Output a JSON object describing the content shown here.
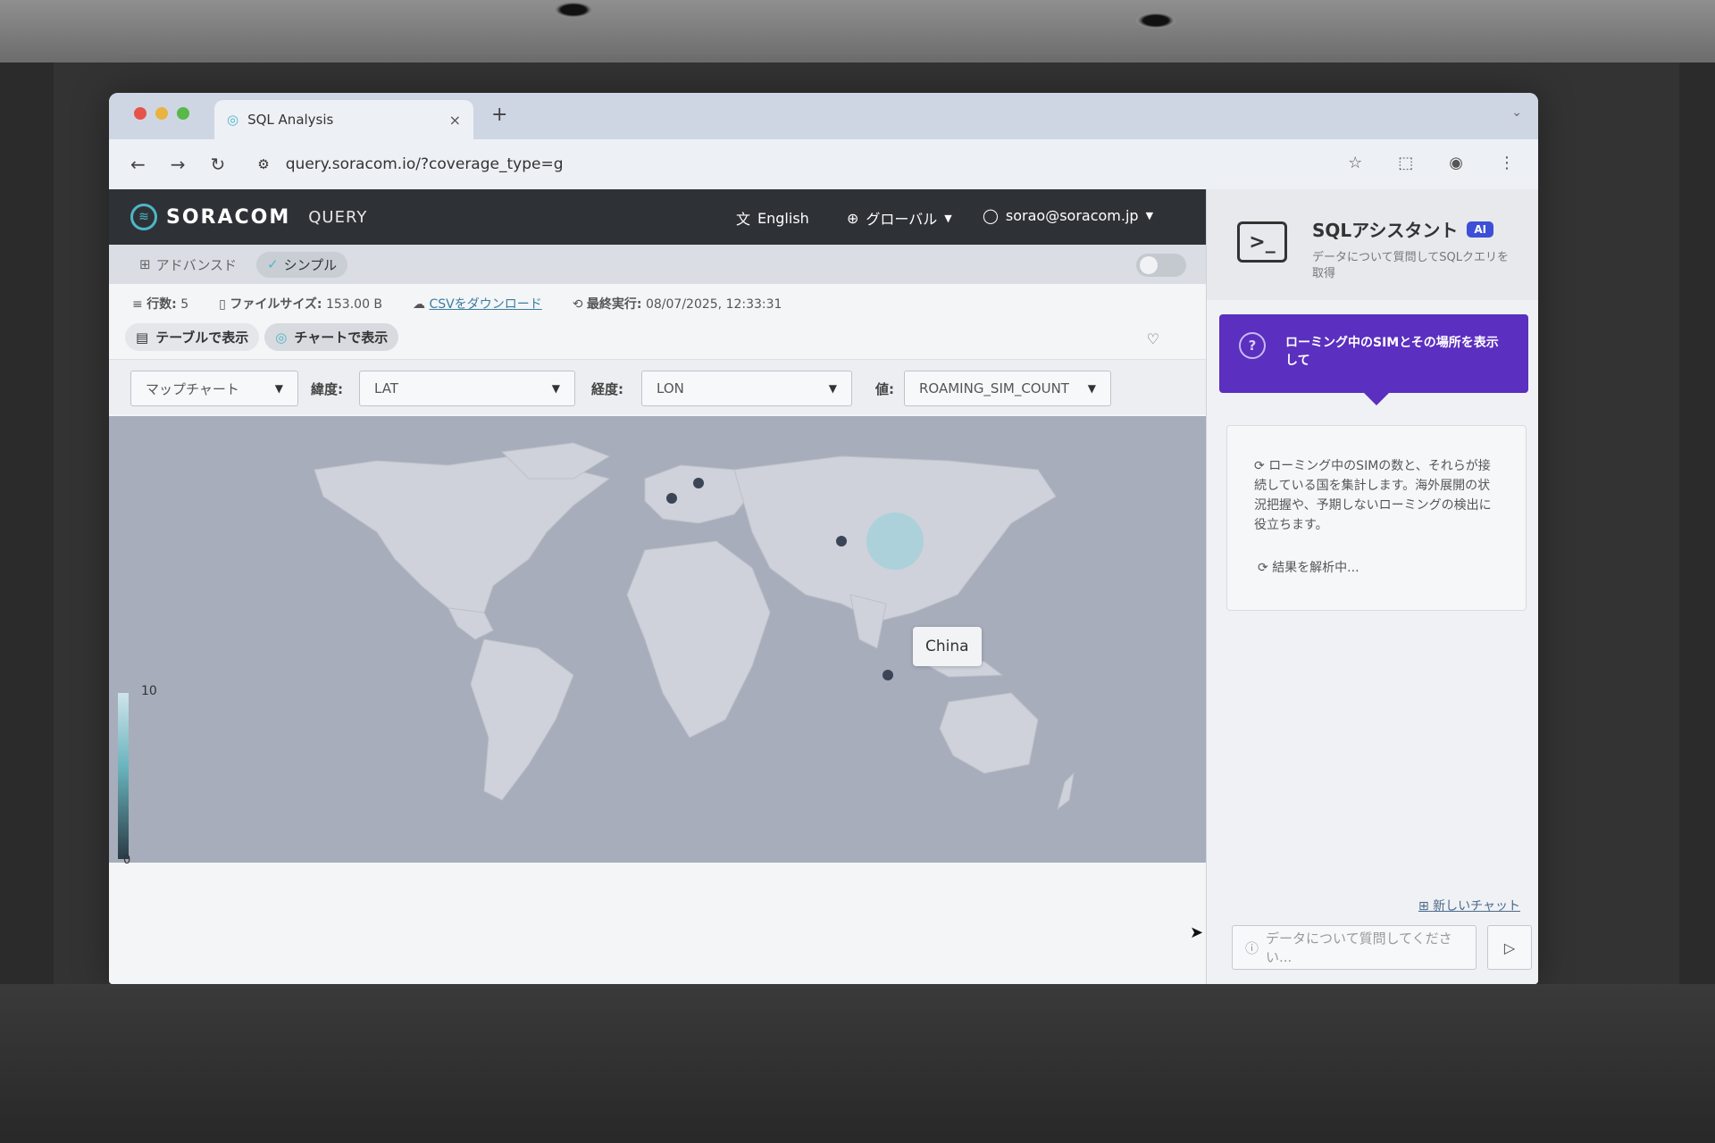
{
  "browser": {
    "tab_title": "SQL Analysis",
    "new_tab": "+",
    "tab_close": "×",
    "url": "query.soracom.io/?coverage_type=g",
    "icons": [
      "back-icon",
      "forward-icon",
      "reload-icon",
      "site-settings-icon",
      "bookmark-star-icon",
      "extensions-icon",
      "profile-icon",
      "menu-kebab-icon"
    ]
  },
  "header": {
    "brand": "SORACOM",
    "product": "QUERY",
    "language": "English",
    "region": "グローバル",
    "user": "sorao@soracom.jp"
  },
  "modes": {
    "advanced": "アドバンスド",
    "simple": "シンプル"
  },
  "meta": {
    "rows_label": "行数:",
    "rows_value": "5",
    "filesize_label": "ファイルサイズ:",
    "filesize_value": "153.00 B",
    "csv_download": "CSVをダウンロード",
    "last_run_label": "最終実行:",
    "last_run_value": "08/07/2025, 12:33:31"
  },
  "views": {
    "table": "テーブルで表示",
    "chart": "チャートで表示"
  },
  "controls": {
    "chart_type": "マップチャート",
    "lat_label": "緯度:",
    "lat_value": "LAT",
    "lon_label": "経度:",
    "lon_value": "LON",
    "value_label": "値:",
    "value_value": "ROAMING_SIM_COUNT"
  },
  "map": {
    "tooltip": "China",
    "legend_max": "10",
    "legend_min": "0",
    "accent": "#8fd0dc"
  },
  "assistant": {
    "title": "SQLアシスタント",
    "badge": "AI",
    "subtitle": "データについて質問してSQLクエリを取得",
    "prompt": "ローミング中のSIMとその場所を表示して",
    "answer": "ローミング中のSIMの数と、それらが接続している国を集計します。海外展開の状況把握や、予期しないローミングの検出に役立ちます。",
    "loading": "結果を解析中...",
    "new_chat": "新しいチャット",
    "input_placeholder": "データについて質問してください..."
  },
  "colors": {
    "header_bg": "#2e3237",
    "accent_purple": "#5b2fbf",
    "ai_badge": "#3d4fd6"
  }
}
